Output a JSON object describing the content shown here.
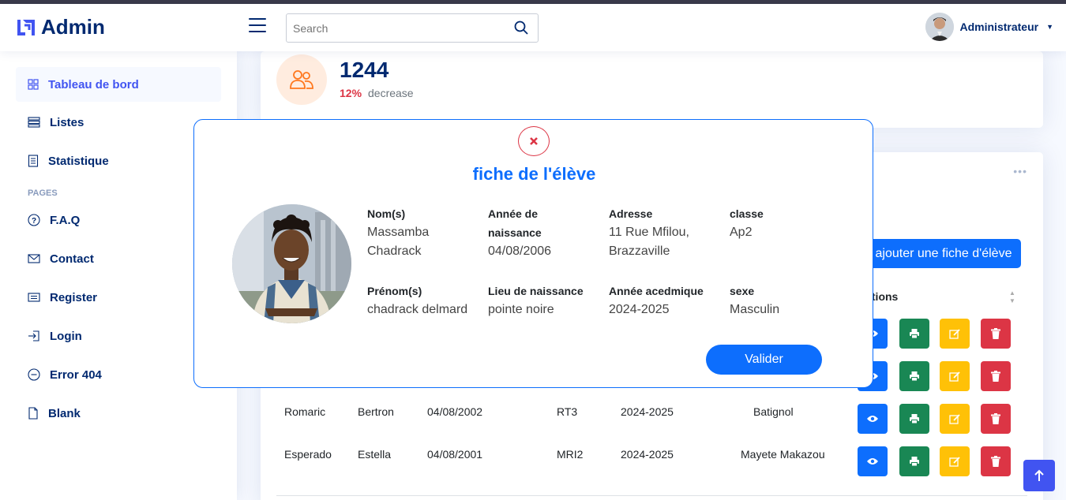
{
  "header": {
    "logo_text": "Admin",
    "search_placeholder": "Search",
    "user_name": "Administrateur"
  },
  "sidebar": {
    "items": [
      {
        "label": "Tableau de bord",
        "icon": "grid-icon"
      },
      {
        "label": "Listes",
        "icon": "list-icon"
      },
      {
        "label": "Statistique",
        "icon": "document-icon"
      }
    ],
    "pages_heading": "PAGES",
    "pages": [
      {
        "label": "F.A.Q",
        "icon": "question-icon"
      },
      {
        "label": "Contact",
        "icon": "envelope-icon"
      },
      {
        "label": "Register",
        "icon": "card-icon"
      },
      {
        "label": "Login",
        "icon": "login-icon"
      },
      {
        "label": "Error 404",
        "icon": "dash-circle-icon"
      },
      {
        "label": "Blank",
        "icon": "file-icon"
      }
    ]
  },
  "stat_card": {
    "count": "1244",
    "percent": "12%",
    "trend": "decrease"
  },
  "list_card": {
    "add_button": "ajouter une fiche d'élève",
    "actions_header": "Actions",
    "rows": [
      {
        "nom": "Romaric",
        "prenom": "Bertron",
        "date": "04/08/2002",
        "classe": "RT3",
        "annee": "2024-2025",
        "lieu": "Batignol"
      },
      {
        "nom": "Esperado",
        "prenom": "Estella",
        "date": "04/08/2001",
        "classe": "MRI2",
        "annee": "2024-2025",
        "lieu": "Mayete Makazou"
      }
    ]
  },
  "modal": {
    "title": "fiche de l'élève",
    "fields": {
      "nom_label": "Nom(s)",
      "nom_value": "Massamba Chadrack",
      "annee_naissance_label": "Année de naissance",
      "annee_naissance_value": "04/08/2006",
      "adresse_label": "Adresse",
      "adresse_value": "11 Rue Mfilou, Brazzaville",
      "classe_label": "classe",
      "classe_value": "Ap2",
      "prenom_label": "Prénom(s)",
      "prenom_value": "chadrack delmard",
      "lieu_label": "Lieu de naissance",
      "lieu_value": "pointe noire",
      "annee_acad_label": "Année acedmique",
      "annee_acad_value": "2024-2025",
      "sexe_label": "sexe",
      "sexe_value": "Masculin"
    },
    "validate_button": "Valider"
  },
  "colors": {
    "primary": "#0d6efd",
    "navy": "#012970",
    "accent": "#4154f1",
    "danger": "#dc3545",
    "success": "#198754",
    "warning": "#ffc107"
  }
}
